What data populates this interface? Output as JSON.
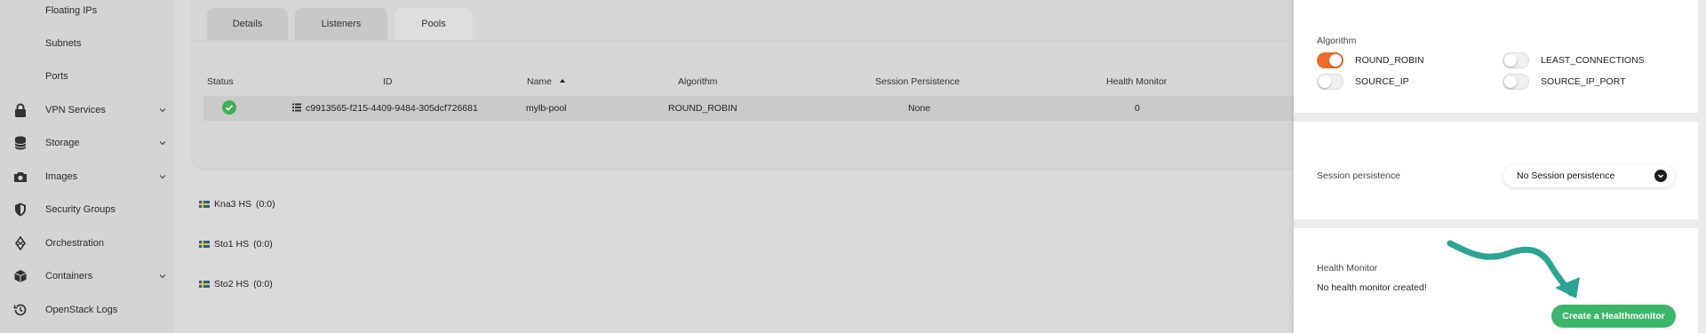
{
  "sidebar": {
    "items": [
      {
        "label": "Floating IPs",
        "icon": "none",
        "has_chevron": false
      },
      {
        "label": "Subnets",
        "icon": "none",
        "has_chevron": false
      },
      {
        "label": "Ports",
        "icon": "none",
        "has_chevron": false
      },
      {
        "label": "VPN Services",
        "icon": "lock-icon",
        "has_chevron": true
      },
      {
        "label": "Storage",
        "icon": "database-icon",
        "has_chevron": true
      },
      {
        "label": "Images",
        "icon": "camera-icon",
        "has_chevron": true
      },
      {
        "label": "Security Groups",
        "icon": "shield-icon",
        "has_chevron": false
      },
      {
        "label": "Orchestration",
        "icon": "orchestration-icon",
        "has_chevron": false
      },
      {
        "label": "Containers",
        "icon": "box-icon",
        "has_chevron": true
      },
      {
        "label": "OpenStack Logs",
        "icon": "history-icon",
        "has_chevron": false
      }
    ]
  },
  "tabs": [
    {
      "label": "Details",
      "active": false
    },
    {
      "label": "Listeners",
      "active": false
    },
    {
      "label": "Pools",
      "active": true
    }
  ],
  "table": {
    "headers": [
      "Status",
      "ID",
      "Name",
      "Algorithm",
      "Session Persistence",
      "Health Monitor"
    ],
    "sorted_column": "Name",
    "rows": [
      {
        "status": "active",
        "id": "c9913565-f215-4409-9484-305dcf726681",
        "name": "mylb-pool",
        "algorithm": "ROUND_ROBIN",
        "session_persistence": "None",
        "health_monitor": "0"
      }
    ]
  },
  "regions": [
    {
      "label": "Kna3 HS",
      "count": "(0:0)"
    },
    {
      "label": "Sto1 HS",
      "count": "(0:0)"
    },
    {
      "label": "Sto2 HS",
      "count": "(0:0)"
    }
  ],
  "panel": {
    "algorithm": {
      "title": "Algorithm",
      "options": [
        {
          "label": "ROUND_ROBIN",
          "on": true
        },
        {
          "label": "LEAST_CONNECTIONS",
          "on": false
        },
        {
          "label": "SOURCE_IP",
          "on": false
        },
        {
          "label": "SOURCE_IP_PORT",
          "on": false
        }
      ]
    },
    "session": {
      "title": "Session persistence",
      "selected": "No Session persistence"
    },
    "health": {
      "title": "Health Monitor",
      "message": "No health monitor created!",
      "button": "Create a Healthmonitor"
    }
  },
  "colors": {
    "accent_orange": "#ef6b2a",
    "success_green": "#3cb66a",
    "status_green": "#3fae5a",
    "arrow_teal": "#2ba592"
  }
}
